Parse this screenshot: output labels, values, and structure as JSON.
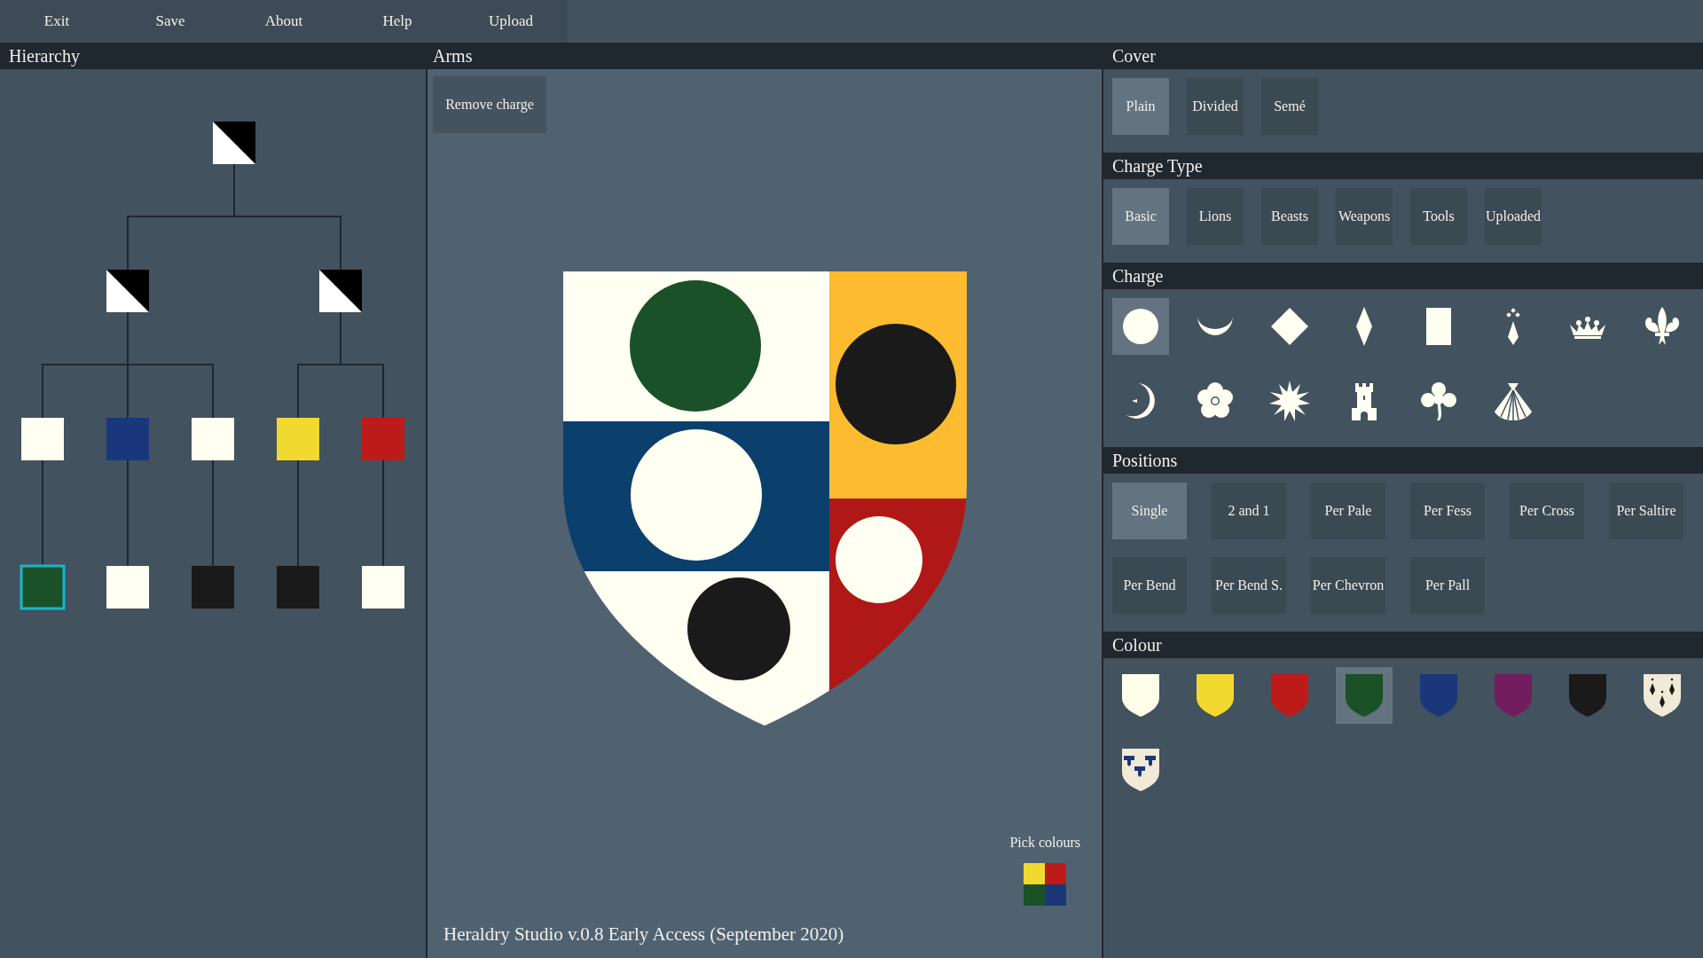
{
  "menu": [
    "Exit",
    "Save",
    "About",
    "Help",
    "Upload"
  ],
  "hierarchy": {
    "title": "Hierarchy",
    "root": {
      "kind": "divided",
      "selected": false,
      "children": [
        {
          "kind": "divided",
          "selected": false,
          "children": [
            {
              "kind": "plain",
              "color": "#fffff2",
              "selected": false,
              "children": [
                {
                  "kind": "plain",
                  "color": "#1a5129",
                  "selected": true
                }
              ]
            },
            {
              "kind": "plain",
              "color": "#1a377e",
              "selected": false,
              "children": [
                {
                  "kind": "plain",
                  "color": "#fffff2",
                  "selected": false
                }
              ]
            },
            {
              "kind": "plain",
              "color": "#fffff2",
              "selected": false,
              "children": [
                {
                  "kind": "plain",
                  "color": "#1a1a1a",
                  "selected": false
                }
              ]
            }
          ]
        },
        {
          "kind": "divided",
          "selected": false,
          "children": [
            {
              "kind": "plain",
              "color": "#f2d930",
              "selected": false,
              "children": [
                {
                  "kind": "plain",
                  "color": "#1a1a1a",
                  "selected": false
                }
              ]
            },
            {
              "kind": "plain",
              "color": "#bd1a1a",
              "selected": false,
              "children": [
                {
                  "kind": "plain",
                  "color": "#fffff2",
                  "selected": false
                }
              ]
            }
          ]
        }
      ]
    }
  },
  "arms": {
    "title": "Arms",
    "remove_button": "Remove charge",
    "shield": {
      "parts": [
        {
          "color": "#fffff2",
          "charge": {
            "color": "#1a5129"
          }
        },
        {
          "color": "#0b3f6c",
          "charge": {
            "color": "#fffff2"
          }
        },
        {
          "color": "#fffff2",
          "charge": {
            "color": "#1a1a1a"
          }
        },
        {
          "color": "#fdbb2f",
          "charge": {
            "color": "#1a1a1a"
          }
        },
        {
          "color": "#b01717",
          "charge": {
            "color": "#fffff2"
          }
        }
      ]
    },
    "pick_colours": "Pick colours",
    "version": "Heraldry Studio v.0.8 Early Access (September 2020)"
  },
  "cover": {
    "title": "Cover",
    "options": [
      {
        "label": "Plain",
        "selected": true
      },
      {
        "label": "Divided",
        "selected": false
      },
      {
        "label": "Semé",
        "selected": false
      }
    ]
  },
  "charge_type": {
    "title": "Charge Type",
    "options": [
      {
        "label": "Basic",
        "selected": true
      },
      {
        "label": "Lions",
        "selected": false
      },
      {
        "label": "Beasts",
        "selected": false
      },
      {
        "label": "Weapons",
        "selected": false
      },
      {
        "label": "Tools",
        "selected": false
      },
      {
        "label": "Uploaded",
        "selected": false
      }
    ]
  },
  "charge": {
    "title": "Charge",
    "items": [
      {
        "kind": "roundel",
        "selected": true
      },
      {
        "kind": "crescent",
        "selected": false
      },
      {
        "kind": "lozenge",
        "selected": false
      },
      {
        "kind": "fusil",
        "selected": false
      },
      {
        "kind": "billet",
        "selected": false
      },
      {
        "kind": "ermine-spot",
        "selected": false
      },
      {
        "kind": "crown",
        "selected": false
      },
      {
        "kind": "fleur",
        "selected": false
      },
      {
        "kind": "moon",
        "selected": false
      },
      {
        "kind": "rose",
        "selected": false
      },
      {
        "kind": "sun",
        "selected": false
      },
      {
        "kind": "tower",
        "selected": false
      },
      {
        "kind": "trefoil",
        "selected": false
      },
      {
        "kind": "shell",
        "selected": false
      }
    ]
  },
  "positions": {
    "title": "Positions",
    "options": [
      {
        "label": "Single",
        "selected": true
      },
      {
        "label": "2 and 1",
        "selected": false
      },
      {
        "label": "Per Pale",
        "selected": false
      },
      {
        "label": "Per Fess",
        "selected": false
      },
      {
        "label": "Per Cross",
        "selected": false
      },
      {
        "label": "Per Saltire",
        "selected": false
      },
      {
        "label": "Per Bend",
        "selected": false
      },
      {
        "label": "Per Bend S.",
        "selected": false
      },
      {
        "label": "Per Chevron",
        "selected": false
      },
      {
        "label": "Per Pall",
        "selected": false
      }
    ]
  },
  "colour": {
    "title": "Colour",
    "swatches": [
      {
        "kind": "plain",
        "color": "#fefee8",
        "selected": false
      },
      {
        "kind": "plain",
        "color": "#f2d930",
        "selected": false
      },
      {
        "kind": "plain",
        "color": "#bd1a1a",
        "selected": false
      },
      {
        "kind": "plain",
        "color": "#1a5126",
        "selected": true
      },
      {
        "kind": "plain",
        "color": "#1a377a",
        "selected": false
      },
      {
        "kind": "plain",
        "color": "#721d5d",
        "selected": false
      },
      {
        "kind": "plain",
        "color": "#1a1a1a",
        "selected": false
      },
      {
        "kind": "ermine",
        "selected": false
      },
      {
        "kind": "potent",
        "selected": false
      }
    ]
  }
}
